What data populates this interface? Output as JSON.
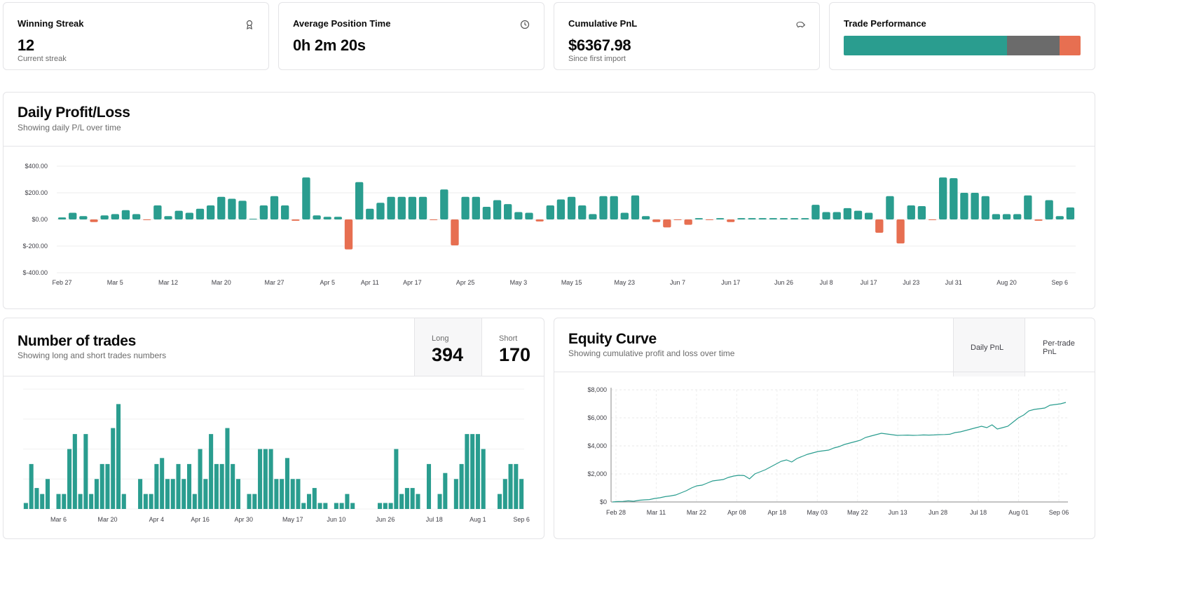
{
  "stats": {
    "winning_streak": {
      "title": "Winning Streak",
      "value": "12",
      "sub": "Current streak",
      "icon": "ribbon-icon"
    },
    "avg_position": {
      "title": "Average Position Time",
      "value": "0h 2m 20s",
      "icon": "clock-icon"
    },
    "cumulative": {
      "title": "Cumulative PnL",
      "value": "$6367.98",
      "sub": "Since first import",
      "icon": "piggy-bank-icon"
    },
    "performance": {
      "title": "Trade Performance",
      "segments": [
        {
          "name": "wins",
          "fraction": 0.69,
          "color": "#2a9d8f"
        },
        {
          "name": "breakeven",
          "fraction": 0.22,
          "color": "#6b6b6b"
        },
        {
          "name": "losses",
          "fraction": 0.09,
          "color": "#e76f51"
        }
      ]
    }
  },
  "daily": {
    "title": "Daily Profit/Loss",
    "subtitle": "Showing daily P/L over time"
  },
  "trades": {
    "title": "Number of trades",
    "subtitle": "Showing long and short trades numbers",
    "long_label": "Long",
    "long_value": "394",
    "short_label": "Short",
    "short_value": "170"
  },
  "equity": {
    "title": "Equity Curve",
    "subtitle": "Showing cumulative profit and loss over time",
    "tabs": [
      "Daily PnL",
      "Per-trade PnL"
    ],
    "active_tab": "Daily PnL"
  },
  "colors": {
    "positive": "#2a9d8f",
    "negative": "#e76f51",
    "neutral": "#6b6b6b"
  },
  "chart_data": [
    {
      "id": "daily",
      "type": "bar",
      "ylim": [
        -400,
        400
      ],
      "yticks": [
        400,
        200,
        0,
        -200,
        -400
      ],
      "ytick_labels": [
        "$400.00",
        "$200.00",
        "$0.00",
        "$-200.00",
        "$-400.00"
      ],
      "xtick_labels": [
        "Feb 27",
        "Mar 5",
        "Mar 12",
        "Mar 20",
        "Mar 27",
        "Apr 5",
        "Apr 11",
        "Apr 17",
        "Apr 25",
        "May 3",
        "May 15",
        "May 23",
        "Jun 7",
        "Jun 17",
        "Jun 26",
        "Jul 8",
        "Jul 17",
        "Jul 23",
        "Jul 31",
        "Aug 20",
        "Sep 6"
      ],
      "xtick_index": [
        0,
        5,
        10,
        15,
        20,
        25,
        29,
        33,
        38,
        43,
        48,
        53,
        58,
        63,
        68,
        72,
        76,
        80,
        84,
        89,
        94
      ],
      "values": [
        15,
        50,
        25,
        -20,
        30,
        40,
        70,
        40,
        -5,
        105,
        25,
        65,
        50,
        80,
        105,
        170,
        155,
        140,
        5,
        105,
        175,
        105,
        -10,
        315,
        30,
        20,
        20,
        -225,
        280,
        80,
        125,
        170,
        170,
        170,
        170,
        -5,
        225,
        -195,
        170,
        170,
        95,
        145,
        115,
        55,
        50,
        -15,
        105,
        150,
        170,
        105,
        40,
        175,
        175,
        50,
        180,
        25,
        -20,
        -60,
        -5,
        -40,
        10,
        -5,
        10,
        -20,
        10,
        10,
        10,
        10,
        10,
        10,
        10,
        110,
        55,
        55,
        85,
        65,
        50,
        -100,
        175,
        -180,
        105,
        100,
        -5,
        315,
        310,
        200,
        200,
        175,
        40,
        40,
        40,
        180,
        -10,
        145,
        25,
        90
      ]
    },
    {
      "id": "trades",
      "type": "bar",
      "ylim": [
        0,
        40
      ],
      "values": [
        2,
        15,
        7,
        5,
        10,
        0,
        5,
        5,
        20,
        25,
        5,
        25,
        5,
        10,
        15,
        15,
        27,
        35,
        5,
        0,
        0,
        10,
        5,
        5,
        15,
        17,
        10,
        10,
        15,
        10,
        15,
        5,
        20,
        10,
        25,
        15,
        15,
        27,
        15,
        10,
        0,
        5,
        5,
        20,
        20,
        20,
        10,
        10,
        17,
        10,
        10,
        2,
        5,
        7,
        2,
        2,
        0,
        2,
        2,
        5,
        2,
        0,
        0,
        0,
        0,
        2,
        2,
        2,
        20,
        5,
        7,
        7,
        5,
        0,
        15,
        0,
        5,
        12,
        0,
        10,
        15,
        25,
        25,
        25,
        20,
        0,
        0,
        5,
        10,
        15,
        15,
        10
      ],
      "xtick_labels": [
        "Mar 6",
        "Mar 20",
        "Apr 4",
        "Apr 16",
        "Apr 30",
        "May 17",
        "Jun 10",
        "Jun 26",
        "Jul 18",
        "Aug 1",
        "Sep 6"
      ],
      "xtick_index": [
        6,
        15,
        24,
        32,
        40,
        49,
        57,
        66,
        75,
        83,
        91
      ]
    },
    {
      "id": "equity",
      "type": "line",
      "ylim": [
        0,
        8000
      ],
      "ytick_labels": [
        "$8,000",
        "$6,000",
        "$4,000",
        "$2,000",
        "$0"
      ],
      "xtick_labels": [
        "Feb 28",
        "Mar 11",
        "Mar 22",
        "Apr 08",
        "Apr 18",
        "May 03",
        "May 22",
        "Jun 13",
        "Jun 28",
        "Jul 18",
        "Aug 01",
        "Sep 06"
      ],
      "y": [
        0,
        30,
        40,
        80,
        50,
        120,
        150,
        170,
        250,
        300,
        380,
        430,
        500,
        650,
        800,
        1000,
        1150,
        1200,
        1350,
        1500,
        1550,
        1600,
        1750,
        1850,
        1900,
        1880,
        1650,
        2000,
        2150,
        2300,
        2500,
        2700,
        2900,
        3000,
        2850,
        3100,
        3250,
        3400,
        3500,
        3600,
        3650,
        3700,
        3850,
        3950,
        4100,
        4200,
        4300,
        4400,
        4600,
        4700,
        4800,
        4900,
        4850,
        4800,
        4750,
        4760,
        4770,
        4750,
        4760,
        4780,
        4770,
        4780,
        4800,
        4810,
        4830,
        4950,
        5000,
        5100,
        5200,
        5300,
        5400,
        5300,
        5500,
        5200,
        5300,
        5400,
        5700,
        6000,
        6200,
        6500,
        6600,
        6650,
        6700,
        6900,
        6950,
        7000,
        7100
      ]
    }
  ]
}
